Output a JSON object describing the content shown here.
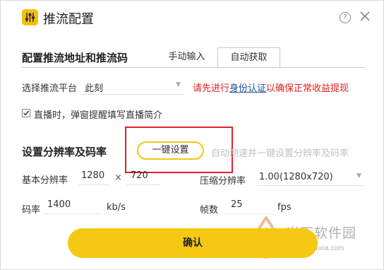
{
  "window": {
    "title": "推流配置",
    "help_label": "?"
  },
  "stream_section": {
    "title": "配置推流地址和推流码",
    "tabs": [
      {
        "label": "手动输入",
        "active": false
      },
      {
        "label": "自动获取",
        "active": true
      }
    ],
    "platform_label": "选择推流平台",
    "platform_value": "此刻",
    "warning_prefix": "请先进行",
    "warning_link": "身份认证",
    "warning_suffix": "以确保正常收益提现",
    "checkbox_label": "直播时，弹窗提醒填写直播简介",
    "checkbox_checked": true
  },
  "resolution_section": {
    "title": "设置分辨率及码率",
    "onekey_button": "一键设置",
    "onekey_hint": "自动测速并一键设置分辨率及码率",
    "base_resolution_label": "基本分辨率",
    "base_width": "1280",
    "times": "×",
    "base_height": "720",
    "compress_label": "压缩分辨率",
    "compress_value": "1.00(1280x720)",
    "bitrate_label": "码率",
    "bitrate_value": "1400",
    "bitrate_unit": "kb/s",
    "framerate_label": "帧数",
    "framerate_value": "25",
    "framerate_unit": "fps"
  },
  "confirm_button": "确认",
  "watermark": {
    "name": "当下软件园",
    "url": "www.downxia.com"
  },
  "colors": {
    "accent": "#f5c813",
    "warning": "#e02020",
    "link": "#1a4f9b",
    "highlight_box": "#e0202a"
  }
}
